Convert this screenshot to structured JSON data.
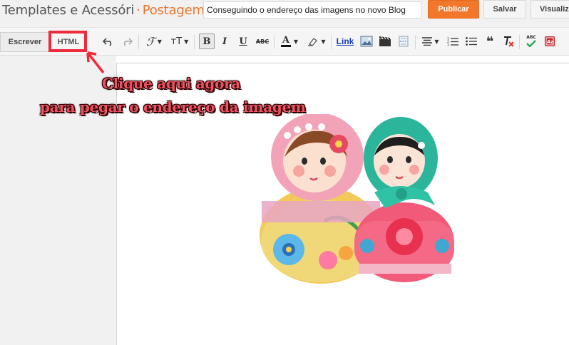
{
  "header": {
    "blog_name": "Templates e Acessóri",
    "separator": "·",
    "section": "Postagem",
    "post_title_value": "Conseguindo o endereço das imagens no novo Blog",
    "publish_label": "Publicar",
    "save_label": "Salvar",
    "preview_label": "Visualiz"
  },
  "toolbar": {
    "compose_tab": "Escrever",
    "html_tab": "HTML",
    "font_size_glyph": "тT",
    "bold_glyph": "B",
    "italic_glyph": "I",
    "underline_glyph": "U",
    "strike_glyph": "ABC",
    "link_label": "Link",
    "quote_glyph": "❝",
    "spell_glyph": "ABC",
    "icons": [
      "undo-icon",
      "redo-icon",
      "font-family-icon",
      "font-size-icon",
      "bold-icon",
      "italic-icon",
      "underline-icon",
      "strikethrough-icon",
      "text-color-icon",
      "highlight-icon",
      "link",
      "image-icon",
      "video-icon",
      "jump-break-icon",
      "align-icon",
      "numbered-list-icon",
      "bullet-list-icon",
      "quote-icon",
      "clear-format-icon",
      "spellcheck-icon",
      "input-tools-icon"
    ]
  },
  "annotation": {
    "line1": "Clique aqui agora",
    "line2": "para pegar o endereço da imagem",
    "color": "#ee2b3b"
  },
  "colors": {
    "accent": "#e8762b",
    "publish_bg": "#f2772b",
    "link": "#1a3fb6"
  }
}
